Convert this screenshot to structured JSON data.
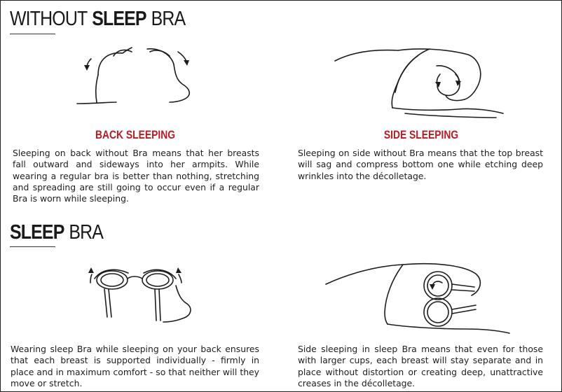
{
  "without": {
    "title_light_1": "WITHOUT",
    "title_bold": "SLEEP",
    "title_light_2": "BRA",
    "back": {
      "label": "BACK SLEEPING",
      "text": "Sleeping on back without Bra means that her breasts fall outward and sideways into her armpits. While wearing a regular bra is better than nothing, stretching and spreading are still going to occur even if a regular Bra is worn while sleeping."
    },
    "side": {
      "label": "SIDE SLEEPING",
      "text": "Sleeping on side without Bra means that the top breast will sag and compress bottom one while etching deep wrinkles into the décolletage."
    }
  },
  "with": {
    "title_bold": "SLEEP",
    "title_light": "BRA",
    "back_text": "Wearing  sleep Bra while sleeping on your back ensures that each breast is supported individually - firmly in place and in maximum comfort - so that neither will they move or stretch.",
    "side_text": "Side sleeping in sleep Bra  means that even for those with larger cups, each breast will stay separate and in place without distortion or creating deep, unattractive creases in the décolletage."
  },
  "icons": [
    "back-no-bra-illustration",
    "side-no-bra-illustration",
    "back-sleep-bra-illustration",
    "side-sleep-bra-illustration"
  ],
  "colors": {
    "accent": "#b51d24",
    "text": "#1e1e1e",
    "rule": "#333333"
  }
}
